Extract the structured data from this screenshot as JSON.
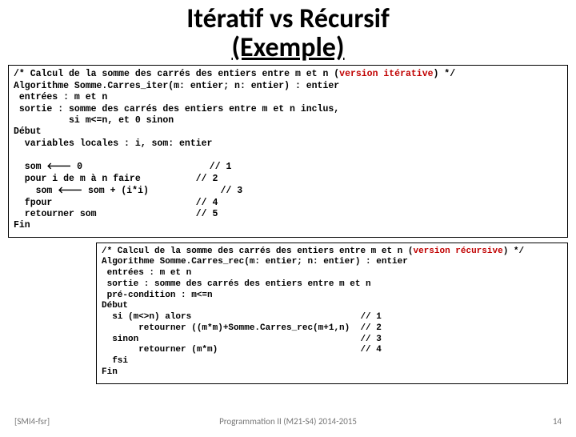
{
  "title_line1": "Itératif vs Récursif",
  "title_line2": "(Exemple)",
  "iter": {
    "c1a": "/* Calcul de la somme des carrés des entiers entre m et n (",
    "c1b": "version itérative",
    "c1c": ") */",
    "l2": "Algorithme Somme.Carres_iter(m: entier; n: entier) : entier",
    "l3": " entrées : m et n",
    "l4": " sortie : somme des carrés des entiers entre m et n inclus,",
    "l5": "          si m<=n, et 0 sinon",
    "l6": "Début",
    "l7": "  variables locales : i, som: entier",
    "blank": "",
    "b1": "  som ",
    "b1v": " 0                       // 1",
    "b2": "  pour i de m à n faire          // 2",
    "b3": "    som ",
    "b3v": " som + (i*i)             // 3",
    "b4": "  fpour                          // 4",
    "b5": "  retourner som                  // 5",
    "b6": "Fin"
  },
  "rec": {
    "c1a": "/* Calcul de la somme des carrés des entiers entre m et n (",
    "c1b": "version récursive",
    "c1c": ") */",
    "l2": "Algorithme Somme.Carres_rec(m: entier; n: entier) : entier",
    "l3": " entrées : m et n",
    "l4": " sortie : somme des carrés des entiers entre m et n",
    "l5": " pré-condition : m<=n",
    "l6": "Début",
    "b1": "  si (m<>n) alors                                // 1",
    "b2": "       retourner ((m*m)+Somme.Carres_rec(m+1,n)  // 2",
    "b3": "  sinon                                          // 3",
    "b4": "       retourner (m*m)                           // 4",
    "b5": "  fsi",
    "b6": "Fin"
  },
  "footer": {
    "left": "[SMI4-fsr]",
    "center": "Programmation II (M21-S4)  2014-2015",
    "page": "14"
  },
  "glyph": {
    "arrow": "🡐"
  }
}
